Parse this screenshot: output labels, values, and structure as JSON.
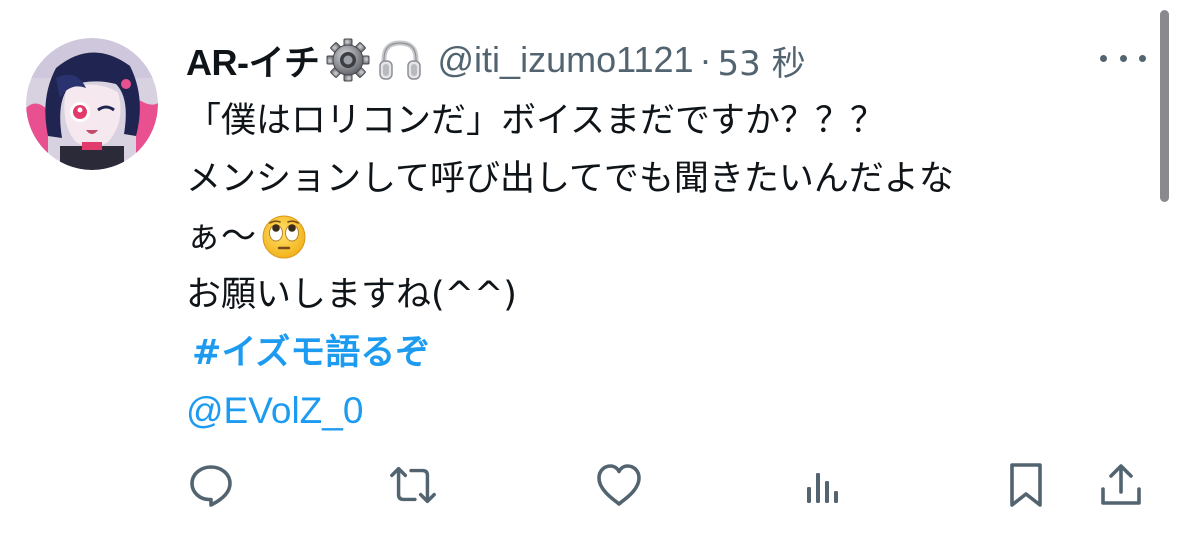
{
  "tweet": {
    "display_name": "AR-イチ",
    "handle": "@iti_izumo1121",
    "separator": "·",
    "time": "53 秒",
    "lines": [
      "「僕はロリコンだ」ボイスまだですか？？？",
      "メンションして呼び出してでも聞きたいんだよな",
      "ぁ〜",
      "お願いしますね(^^)"
    ],
    "hashtag": "#イズモ語るぞ",
    "mention": "@EVolZ_0"
  },
  "icons": {
    "badges": [
      "gear-icon",
      "headphones-icon"
    ],
    "emoji": "eye-roll-emoji-icon",
    "more": "more-options-icon",
    "actions": [
      "reply-icon",
      "retweet-icon",
      "like-icon",
      "views-icon",
      "bookmark-icon",
      "share-icon"
    ]
  },
  "colors": {
    "text": "#0f1419",
    "secondary": "#536471",
    "link": "#1d9bf0",
    "background": "#ffffff"
  }
}
